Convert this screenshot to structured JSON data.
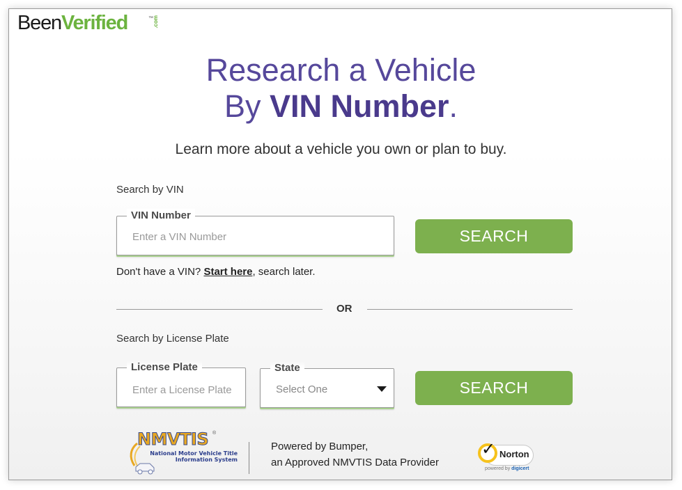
{
  "brand": {
    "name_part1": "Been",
    "name_part2": "Verified",
    "suffix": ".com",
    "trademark": "™",
    "colors": {
      "primary_green": "#6cb33f",
      "heading_purple": "#4a3a8c",
      "button_green": "#7db04e"
    }
  },
  "hero": {
    "title_line1": "Research a Vehicle",
    "title_line2_prefix": "By ",
    "title_line2_bold": "VIN Number",
    "title_line2_suffix": ".",
    "subtitle": "Learn more about a vehicle you own or plan to buy."
  },
  "vin_search": {
    "section_label": "Search by VIN",
    "field_label": "VIN Number",
    "placeholder": "Enter a VIN Number",
    "value": "",
    "button_label": "SEARCH",
    "helper_prefix": "Don't have a VIN? ",
    "helper_link": "Start here",
    "helper_suffix": ", search later."
  },
  "divider": {
    "label": "OR"
  },
  "plate_search": {
    "section_label": "Search by License Plate",
    "plate_label": "License Plate",
    "plate_placeholder": "Enter a License Plate",
    "plate_value": "",
    "state_label": "State",
    "state_selected": "Select One",
    "button_label": "SEARCH"
  },
  "footer": {
    "nmvtis_logo_text": "NMVTIS",
    "nmvtis_registered": "®",
    "nmvtis_subtitle_line1": "National Motor Vehicle Title",
    "nmvtis_subtitle_line2": "Information System",
    "powered_line1": "Powered by Bumper,",
    "powered_line2": "an Approved NMVTIS Data Provider",
    "norton_word": "Norton",
    "norton_powered_by": "powered by ",
    "norton_digicert": "digicert"
  },
  "icons": {
    "dropdown": "caret-down-icon",
    "norton_check": "checkmark-icon"
  }
}
